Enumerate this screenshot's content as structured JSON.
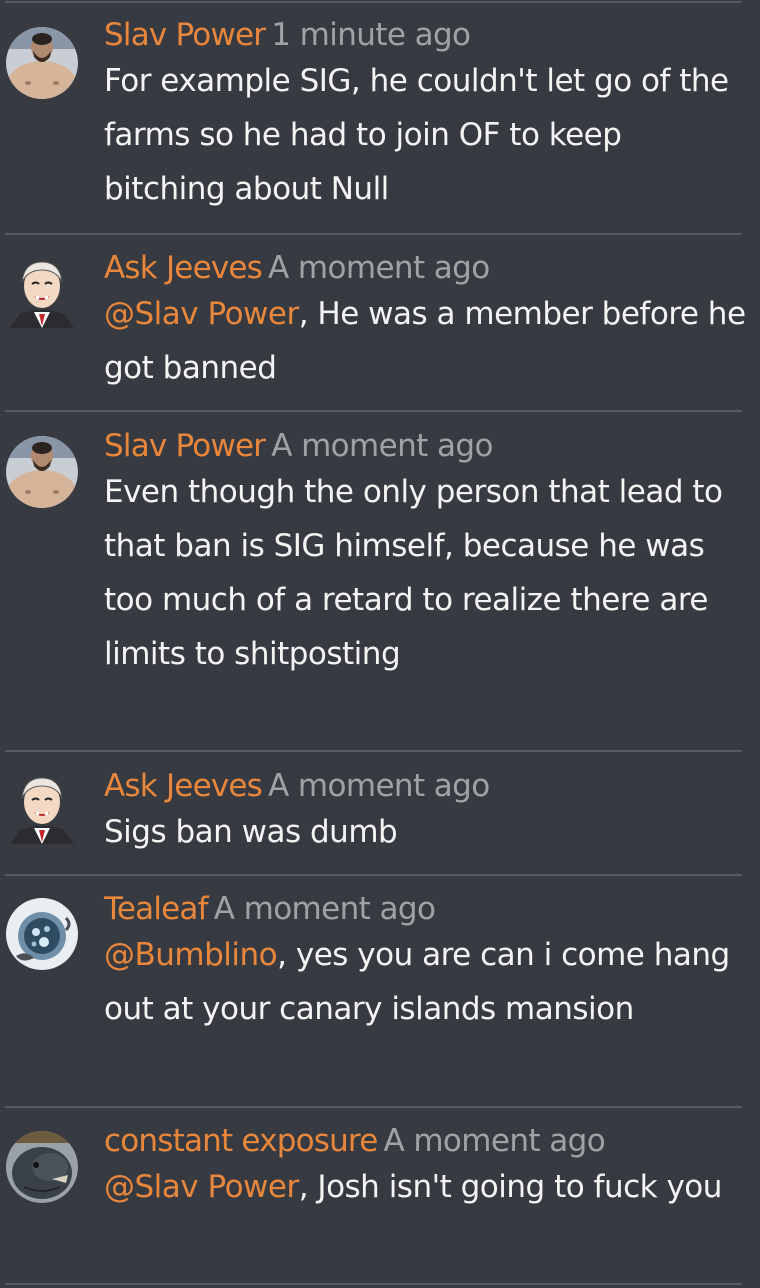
{
  "comments": [
    {
      "author": "Slav Power",
      "time": "1 minute ago",
      "mention": "",
      "text": "For example SIG, he couldn't let go of the farms so he had to join OF to keep bitching about Null",
      "avatar_icon": "bearded-man-avatar-icon"
    },
    {
      "author": "Ask Jeeves",
      "time": "A moment ago",
      "mention": "@Slav Power",
      "text": ", He was a member before he got banned",
      "avatar_icon": "anime-butler-avatar-icon"
    },
    {
      "author": "Slav Power",
      "time": "A moment ago",
      "mention": "",
      "text": "Even though the only person that lead to that ban is SIG himself, because he was too much of a retard to realize there are limits to shitposting",
      "avatar_icon": "bearded-man-avatar-icon"
    },
    {
      "author": "Ask Jeeves",
      "time": "A moment ago",
      "mention": "",
      "text": "Sigs ban was dumb",
      "avatar_icon": "anime-butler-avatar-icon"
    },
    {
      "author": "Tealeaf",
      "time": "A moment ago",
      "mention": "@Bumblino",
      "text": ", yes you are can i come hang out at your canary islands mansion",
      "avatar_icon": "teacup-avatar-icon"
    },
    {
      "author": "constant exposure",
      "time": "A moment ago",
      "mention": "@Slav Power",
      "text": ", Josh isn't going to fuck you",
      "avatar_icon": "creature-avatar-icon"
    }
  ],
  "colors": {
    "background": "#373a41",
    "divider": "#56595f",
    "author": "#e8873c",
    "timestamp": "#a0a2a6",
    "text": "#f4f4f4"
  }
}
